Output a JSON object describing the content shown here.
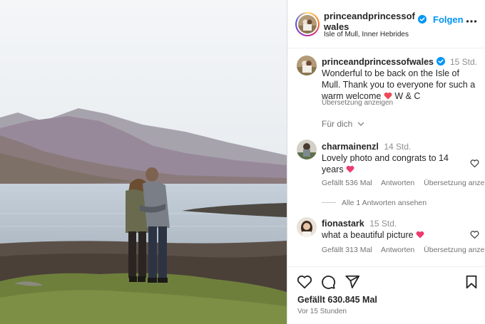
{
  "post": {
    "image_alt": "Couple embracing on a lakeshore with mountains in the distance"
  },
  "header": {
    "username": "princeandprincessofwales",
    "follow_label": "Folgen",
    "location": "Isle of Mull, Inner Hebrides"
  },
  "caption": {
    "username": "princeandprincessofwales",
    "time": "15 Std.",
    "text": "Wonderful to be back on the Isle of Mull. Thank you to everyone for such a warm welcome",
    "signature": "W & C",
    "translate_label": "Übersetzung anzeigen"
  },
  "for_you_label": "Für dich",
  "comments": [
    {
      "username": "charmainenzl",
      "time": "14 Std.",
      "text": "Lovely photo and congrats to 14 years",
      "likes": "Gefällt 536 Mal",
      "reply": "Antworten",
      "translate": "Übersetzung anzeigen",
      "view_replies": "Alle 1 Antworten ansehen"
    },
    {
      "username": "fionastark",
      "time": "15 Std.",
      "text": "what a beautiful picture",
      "likes": "Gefällt 313 Mal",
      "reply": "Antworten",
      "translate": "Übersetzung anzeigen"
    }
  ],
  "footer": {
    "likes": "Gefällt 630.845 Mal",
    "posted_ago": "Vor 15 Stunden"
  },
  "colors": {
    "accent": "#0095f6",
    "heart": "#ed4956"
  }
}
